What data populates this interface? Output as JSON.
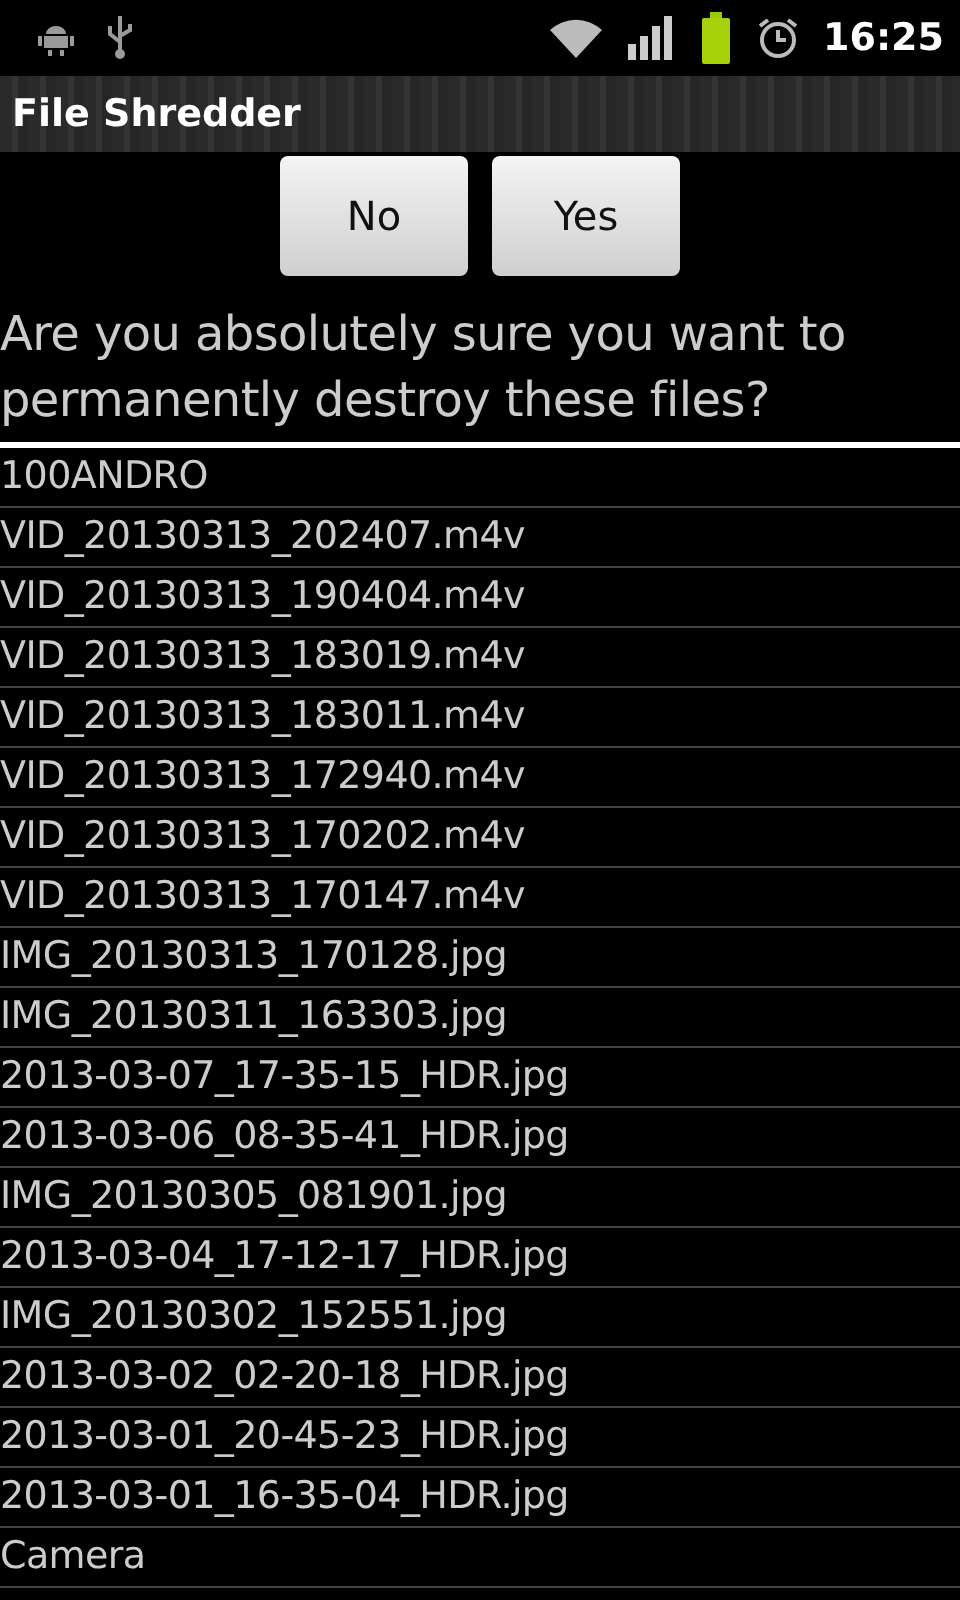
{
  "status_bar": {
    "time": "16:25"
  },
  "window": {
    "title": "File Shredder"
  },
  "buttons": [
    "No",
    "Yes"
  ],
  "question": "Are you absolutely sure you want to permanently destroy these files?",
  "files": [
    "100ANDRO",
    "VID_20130313_202407.m4v",
    "VID_20130313_190404.m4v",
    "VID_20130313_183019.m4v",
    "VID_20130313_183011.m4v",
    "VID_20130313_172940.m4v",
    "VID_20130313_170202.m4v",
    "VID_20130313_170147.m4v",
    "IMG_20130313_170128.jpg",
    "IMG_20130311_163303.jpg",
    "2013-03-07_17-35-15_HDR.jpg",
    "2013-03-06_08-35-41_HDR.jpg",
    "IMG_20130305_081901.jpg",
    "2013-03-04_17-12-17_HDR.jpg",
    "IMG_20130302_152551.jpg",
    "2013-03-02_02-20-18_HDR.jpg",
    "2013-03-01_20-45-23_HDR.jpg",
    "2013-03-01_16-35-04_HDR.jpg",
    "Camera"
  ]
}
